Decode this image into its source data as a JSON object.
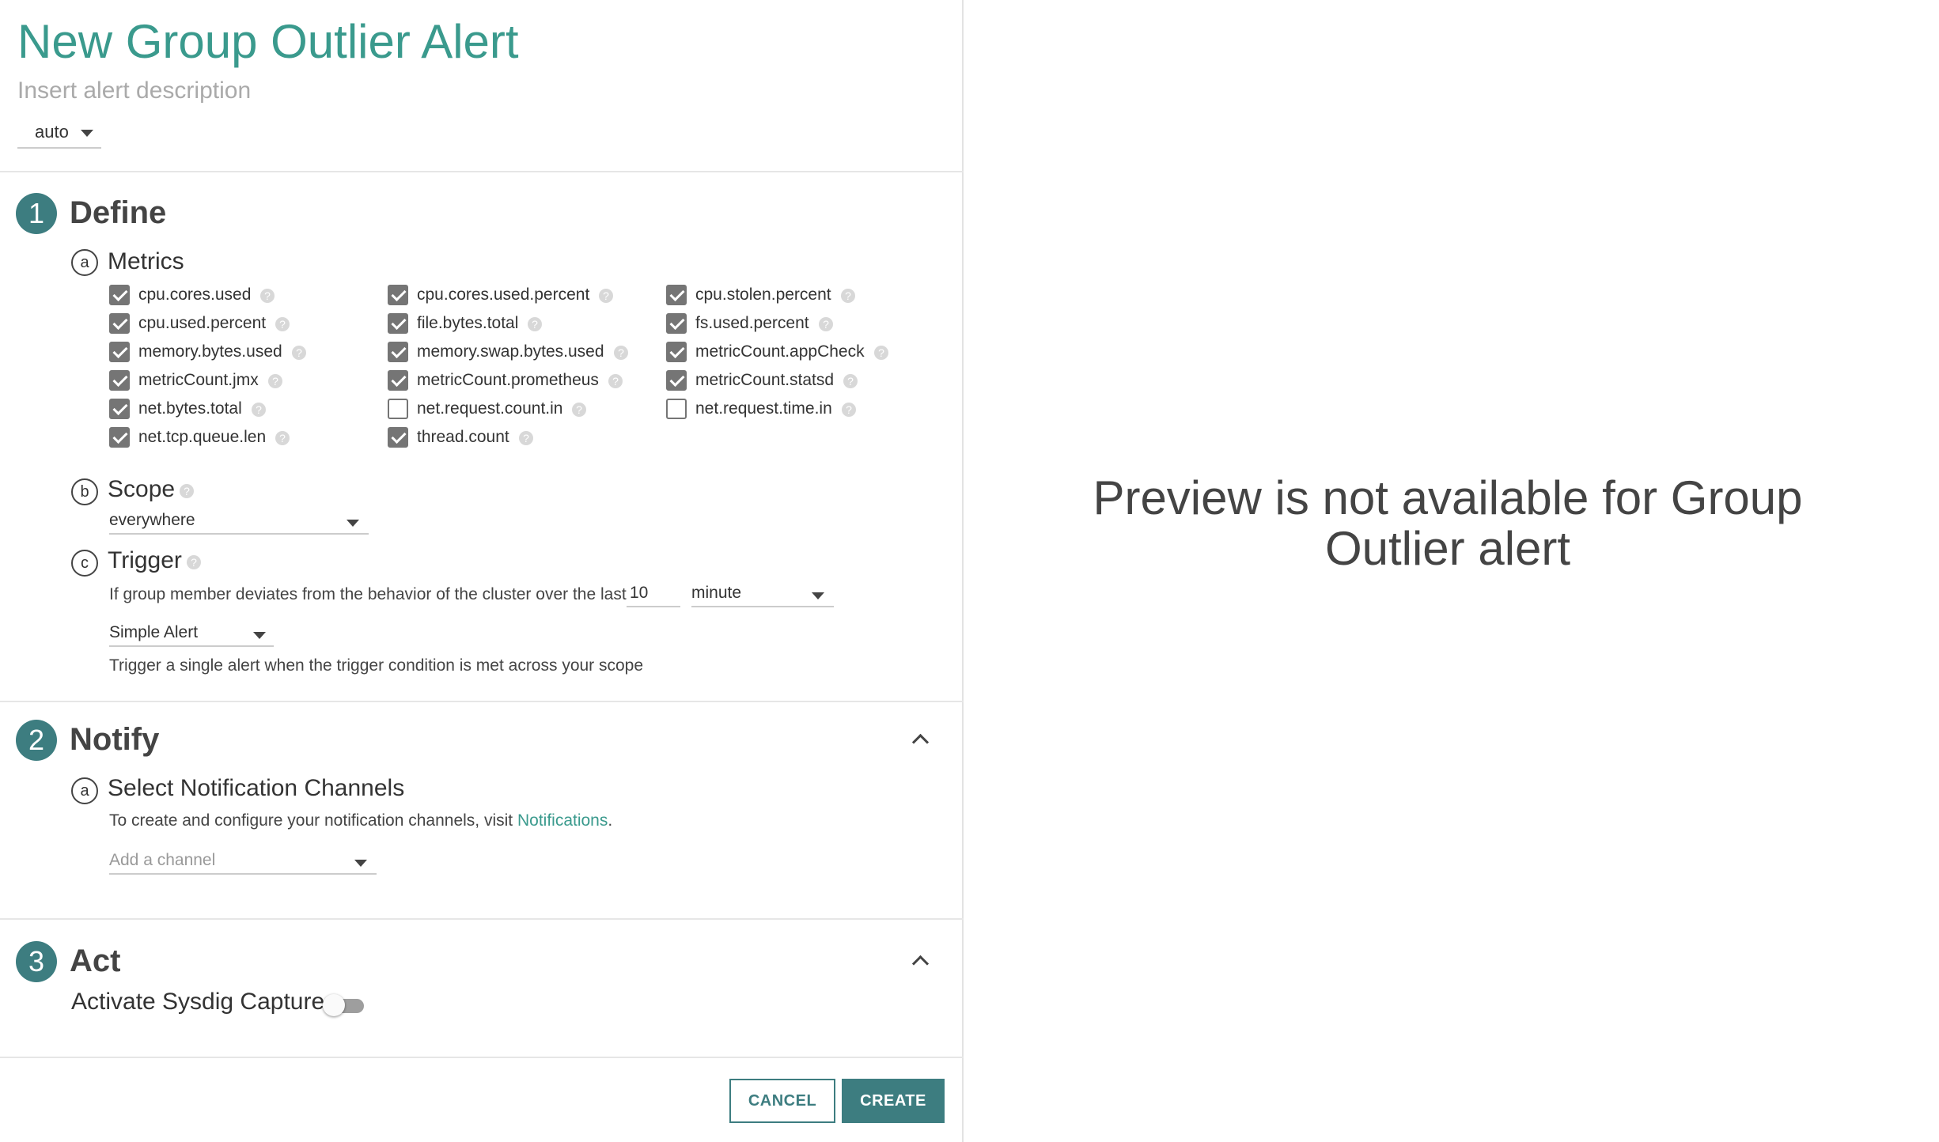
{
  "header": {
    "title": "New Group Outlier Alert",
    "description_placeholder": "Insert alert description",
    "severity_select": "auto"
  },
  "define": {
    "step_number": "1",
    "title": "Define",
    "metrics": {
      "badge": "a",
      "title": "Metrics",
      "items": [
        {
          "label": "cpu.cores.used",
          "checked": true
        },
        {
          "label": "cpu.cores.used.percent",
          "checked": true
        },
        {
          "label": "cpu.stolen.percent",
          "checked": true
        },
        {
          "label": "cpu.used.percent",
          "checked": true
        },
        {
          "label": "file.bytes.total",
          "checked": true
        },
        {
          "label": "fs.used.percent",
          "checked": true
        },
        {
          "label": "memory.bytes.used",
          "checked": true
        },
        {
          "label": "memory.swap.bytes.used",
          "checked": true
        },
        {
          "label": "metricCount.appCheck",
          "checked": true
        },
        {
          "label": "metricCount.jmx",
          "checked": true
        },
        {
          "label": "metricCount.prometheus",
          "checked": true
        },
        {
          "label": "metricCount.statsd",
          "checked": true
        },
        {
          "label": "net.bytes.total",
          "checked": true
        },
        {
          "label": "net.request.count.in",
          "checked": false
        },
        {
          "label": "net.request.time.in",
          "checked": false
        },
        {
          "label": "net.tcp.queue.len",
          "checked": true
        },
        {
          "label": "thread.count",
          "checked": true
        }
      ]
    },
    "scope": {
      "badge": "b",
      "title": "Scope",
      "value": "everywhere"
    },
    "trigger": {
      "badge": "c",
      "title": "Trigger",
      "condition_text": "If group member deviates from the behavior of the cluster over the last",
      "duration_value": "10",
      "duration_unit": "minute",
      "alert_type": "Simple Alert",
      "alert_type_description": "Trigger a single alert when the trigger condition is met across your scope"
    }
  },
  "notify": {
    "step_number": "2",
    "title": "Notify",
    "channels": {
      "badge": "a",
      "title": "Select Notification Channels",
      "help_text": "To create and configure your notification channels, visit",
      "link_text": "Notifications",
      "link_suffix": ".",
      "placeholder": "Add a channel"
    }
  },
  "act": {
    "step_number": "3",
    "title": "Act",
    "capture_label": "Activate Sysdig Capture",
    "capture_enabled": false
  },
  "footer": {
    "cancel_label": "CANCEL",
    "create_label": "CREATE"
  },
  "preview": {
    "message": "Preview is not available for Group Outlier alert"
  },
  "colors": {
    "accent": "#3d7d80",
    "title_teal": "#3a9a8d",
    "checkbox": "#757575"
  }
}
